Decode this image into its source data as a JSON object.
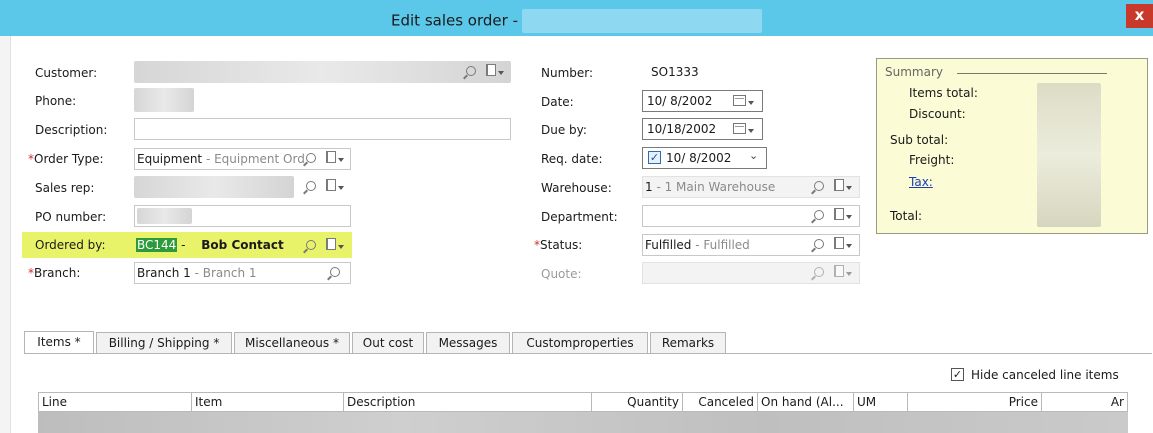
{
  "window": {
    "title": "Edit sales order -",
    "close_label": "x"
  },
  "form": {
    "customer_label": "Customer:",
    "phone_label": "Phone:",
    "description_label": "Description:",
    "order_type_label": "Order Type:",
    "order_type_value": "Equipment",
    "order_type_desc": " - Equipment Ord",
    "sales_rep_label": "Sales rep:",
    "po_number_label": "PO number:",
    "ordered_by_label": "Ordered by:",
    "ordered_by_code": "BC144",
    "ordered_by_sep": " - ",
    "ordered_by_name": "Bob Contact",
    "branch_label": "Branch:",
    "branch_value": "Branch 1",
    "branch_desc": " - Branch 1",
    "required_mark": "*"
  },
  "order": {
    "number_label": "Number:",
    "number_value": "SO1333",
    "date_label": "Date:",
    "date_value": "10/ 8/2002",
    "due_by_label": "Due by:",
    "due_by_value": "10/18/2002",
    "req_date_label": "Req. date:",
    "req_date_value": "10/ 8/2002",
    "warehouse_label": "Warehouse:",
    "warehouse_value": "1",
    "warehouse_desc": " - 1 Main Warehouse",
    "department_label": "Department:",
    "status_label": "Status:",
    "status_value": "Fulfilled",
    "status_desc": " - Fulfilled",
    "quote_label": "Quote:"
  },
  "summary": {
    "title": "Summary",
    "items_total_label": "Items total:",
    "discount_label": "Discount:",
    "sub_total_label": "Sub total:",
    "freight_label": "Freight:",
    "tax_label": "Tax:",
    "total_label": "Total:"
  },
  "tabs": [
    {
      "label": "Items *"
    },
    {
      "label": "Billing / Shipping  *"
    },
    {
      "label": "Miscellaneous *"
    },
    {
      "label": "Out cost"
    },
    {
      "label": "Messages"
    },
    {
      "label": "Customproperties"
    },
    {
      "label": "Remarks"
    }
  ],
  "items": {
    "hide_canceled_label": "Hide canceled line items",
    "hide_canceled_checked": true,
    "columns": [
      "Line",
      "Item",
      "Description",
      "Quantity",
      "Canceled",
      "On hand (Al...",
      "UM",
      "Price",
      "Ar"
    ]
  },
  "colors": {
    "titlebar": "#5bc8ea",
    "highlight": "#e9f36a",
    "summary_bg": "#fbfbd6",
    "required": "#d0302a",
    "link": "#1a3fb5"
  }
}
